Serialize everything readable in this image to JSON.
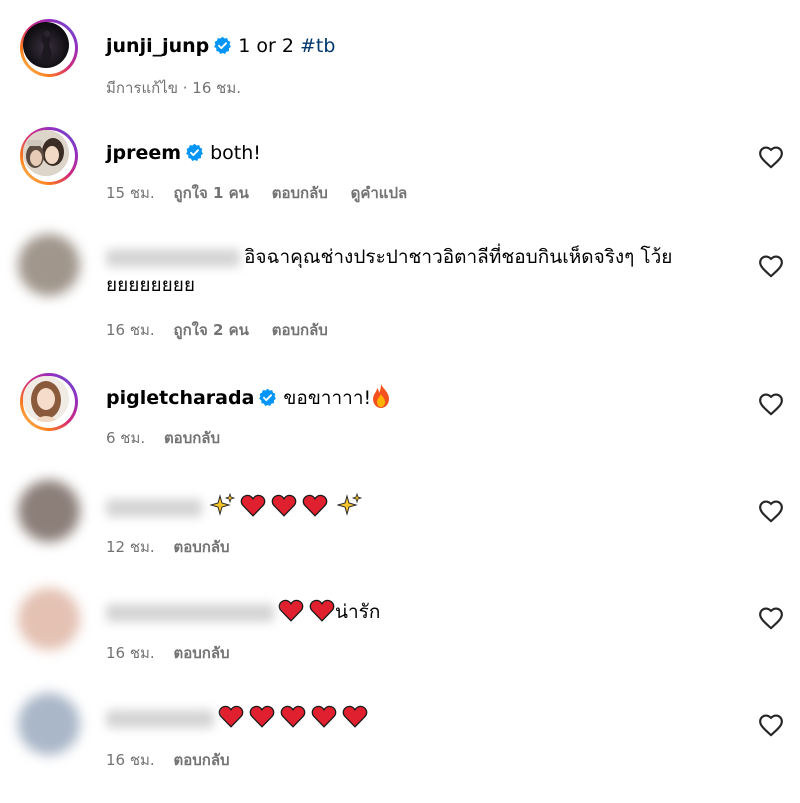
{
  "comments": [
    {
      "username": "junji_junp",
      "verified": true,
      "text": "1 or 2",
      "hashtag": "#tb",
      "time": "มีการแก้ไข · 16 ชม."
    },
    {
      "username": "jpreem",
      "verified": true,
      "text": "both!",
      "time": "15 ชม.",
      "likes": "ถูกใจ 1 คน",
      "reply": "ตอบกลับ",
      "translate": "ดูคำแปล"
    },
    {
      "username": "",
      "text_line1": "อิจฉาคุณช่างประปาชาวอิตาลีที่ชอบกินเห็ดจริงๆ โว้ย",
      "text_line2": "ยยยยยยยย",
      "time": "16 ชม.",
      "likes": "ถูกใจ 2 คน",
      "reply": "ตอบกลับ"
    },
    {
      "username": "pigletcharada",
      "verified": true,
      "text": "ขอขาาาา!",
      "time": "6 ชม.",
      "reply": "ตอบกลับ"
    },
    {
      "username": "",
      "text": "",
      "time": "12 ชม.",
      "reply": "ตอบกลับ"
    },
    {
      "username": "",
      "text": "น่ารัก",
      "time": "16 ชม.",
      "reply": "ตอบกลับ"
    },
    {
      "username": "",
      "text": "",
      "time": "16 ชม.",
      "reply": "ตอบกลับ"
    }
  ],
  "colors": {
    "verified": "#0095f6",
    "hashtag": "#00376b",
    "meta": "#737373",
    "emoji_heart": "#e0202e"
  }
}
